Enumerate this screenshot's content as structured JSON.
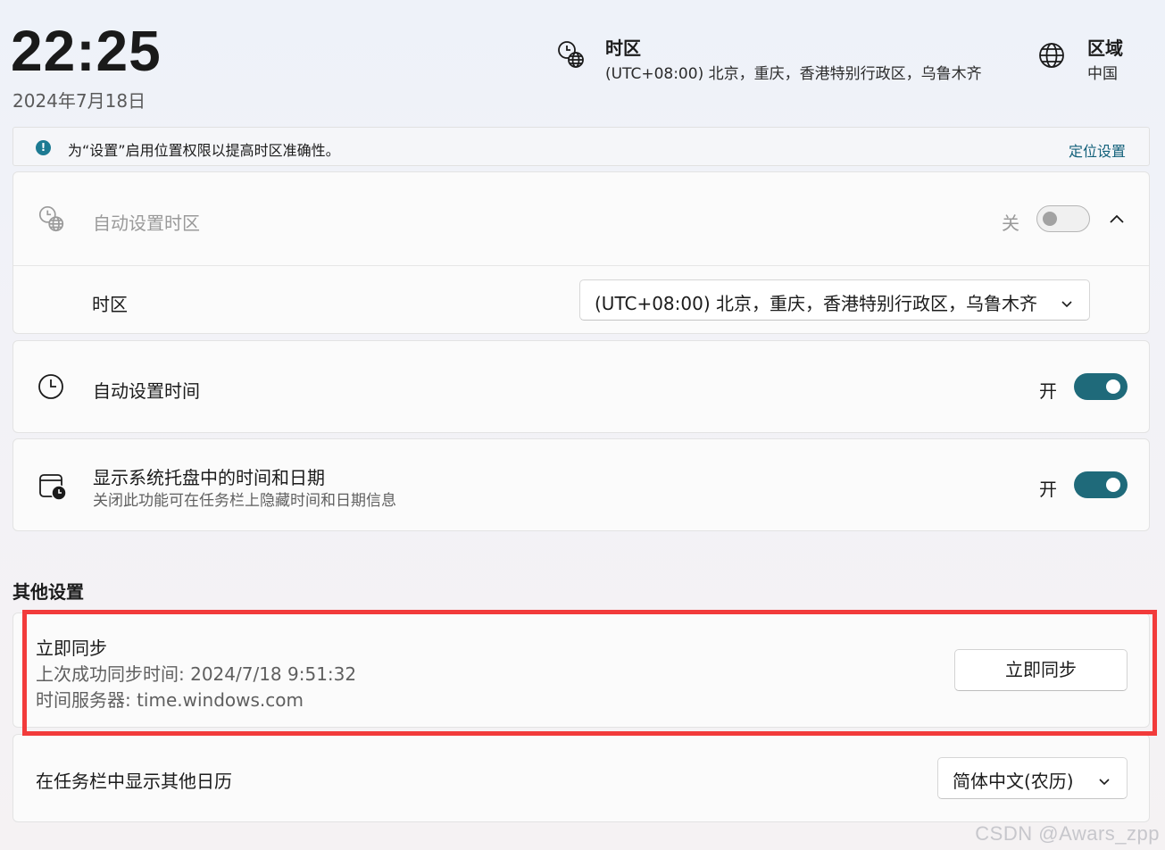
{
  "header": {
    "time": "22:25",
    "date": "2024年7月18日",
    "timezone": {
      "title": "时区",
      "value": "(UTC+08:00) 北京，重庆，香港特别行政区，乌鲁木齐",
      "icon": "clock-globe-icon"
    },
    "region": {
      "title": "区域",
      "value": "中国",
      "icon": "globe-icon"
    }
  },
  "info_bar": {
    "icon": "info-icon",
    "message": "为“设置”启用位置权限以提高时区准确性。",
    "link": "定位设置",
    "accent": "#1d7b93"
  },
  "auto_timezone": {
    "label": "自动设置时区",
    "state_label": "关",
    "enabled": false,
    "disabled_look": true,
    "icon": "clock-globe-icon",
    "expand_icon": "chevron-up-icon",
    "timezone_field": {
      "label": "时区",
      "selected": "(UTC+08:00) 北京，重庆，香港特别行政区，乌鲁木齐"
    }
  },
  "auto_time": {
    "label": "自动设置时间",
    "state_label": "开",
    "enabled": true,
    "icon": "clock-icon"
  },
  "tray_time": {
    "label": "显示系统托盘中的时间和日期",
    "description": "关闭此功能可在任务栏上隐藏时间和日期信息",
    "state_label": "开",
    "enabled": true,
    "icon": "calendar-clock-icon"
  },
  "other_settings": {
    "heading": "其他设置",
    "sync": {
      "title": "立即同步",
      "last_sync": "上次成功同步时间: 2024/7/18 9:51:32",
      "server": "时间服务器: time.windows.com",
      "button_label": "立即同步"
    },
    "calendar": {
      "label": "在任务栏中显示其他日历",
      "selected": "简体中文(农历)"
    }
  },
  "colors": {
    "toggle_on": "#1f6a7a",
    "highlight": "#f23b3b",
    "link": "#12607a"
  },
  "watermark": "CSDN @Awars_zpp"
}
